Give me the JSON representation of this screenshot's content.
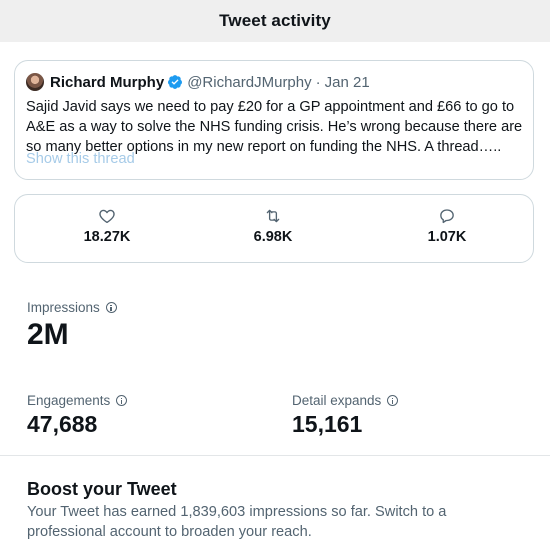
{
  "header": {
    "title": "Tweet activity"
  },
  "tweet": {
    "author_name": "Richard Murphy",
    "handle": "@RichardJMurphy",
    "separator": "·",
    "date": "Jan 21",
    "text": "Sajid Javid says we need to pay £20 for a GP appointment and £66 to go to A&E as a way to solve the NHS funding crisis. He’s wrong because there are so many better options in my new report on funding the NHS. A thread…..",
    "show_thread": "Show this thread",
    "verified_color": "#1d9bf0"
  },
  "engagement": {
    "likes": {
      "icon": "heart-icon",
      "value": "18.27K"
    },
    "retweets": {
      "icon": "retweet-icon",
      "value": "6.98K"
    },
    "replies": {
      "icon": "reply-icon",
      "value": "1.07K"
    }
  },
  "metrics": {
    "impressions": {
      "label": "Impressions",
      "value": "2M"
    },
    "engagements": {
      "label": "Engagements",
      "value": "47,688"
    },
    "detail_expands": {
      "label": "Detail expands",
      "value": "15,161"
    }
  },
  "boost": {
    "title": "Boost your Tweet",
    "text": "Your Tweet has earned 1,839,603 impressions so far. Switch to a professional account to broaden your reach."
  }
}
